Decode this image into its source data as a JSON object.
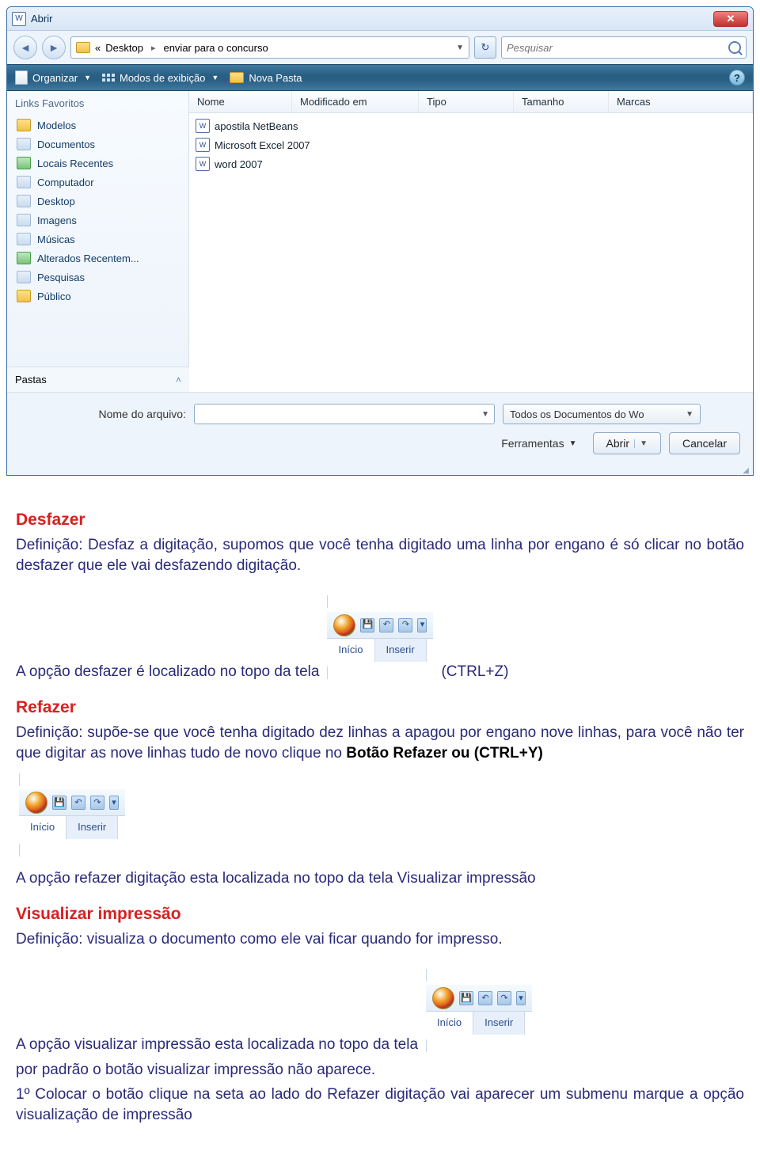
{
  "dialog": {
    "title": "Abrir",
    "breadcrumb": {
      "levels_icon": "«",
      "root": "Desktop",
      "current": "enviar para o concurso"
    },
    "search_placeholder": "Pesquisar",
    "toolbar": {
      "organize": "Organizar",
      "views": "Modos de exibição",
      "new_folder": "Nova Pasta"
    },
    "sidebar": {
      "heading": "Links Favoritos",
      "items": [
        "Modelos",
        "Documentos",
        "Locais Recentes",
        "Computador",
        "Desktop",
        "Imagens",
        "Músicas",
        "Alterados Recentem...",
        "Pesquisas",
        "Público"
      ],
      "footer": "Pastas"
    },
    "columns": {
      "name": "Nome",
      "modified": "Modificado em",
      "type": "Tipo",
      "size": "Tamanho",
      "tags": "Marcas"
    },
    "files": [
      "apostila NetBeans",
      "Microsoft Excel 2007",
      "word 2007"
    ],
    "bottom": {
      "filename_label": "Nome do arquivo:",
      "filetype_label": "Todos os Documentos do Wo",
      "tools": "Ferramentas",
      "open": "Abrir",
      "cancel": "Cancelar"
    }
  },
  "doc": {
    "h_desfazer": "Desfazer",
    "p_desfazer": "Definição: Desfaz a digitação, supomos que você tenha digitado uma linha por engano é só clicar no botão desfazer que ele vai desfazendo digitação.",
    "p_desfazer_loc_before": "A opção desfazer é localizado no topo da tela",
    "p_desfazer_loc_after": "(CTRL+Z)",
    "h_refazer": "Refazer",
    "p_refazer_1": "Definição: supõe-se que você tenha digitado dez linhas a apagou por engano nove linhas, para você não ter que digitar as nove linhas tudo de novo clique no ",
    "p_refazer_bold": "Botão Refazer ou (CTRL+Y)",
    "p_refazer_loc": "A opção refazer digitação esta localizada no topo da tela Visualizar impressão",
    "h_visualizar": "Visualizar impressão",
    "p_visualizar_def": "Definição: visualiza o documento como ele vai ficar quando for impresso.",
    "p_vis_loc_before": "A opção visualizar impressão esta localizada no topo da tela",
    "p_vis_loc_after": "por padrão o botão visualizar impressão não aparece.",
    "p_vis_step": "1º Colocar o botão clique na seta ao lado do Refazer digitação vai aparecer um submenu marque a opção visualização de impressão",
    "ribbon": {
      "tab_inicio": "Início",
      "tab_inserir": "Inserir"
    }
  }
}
